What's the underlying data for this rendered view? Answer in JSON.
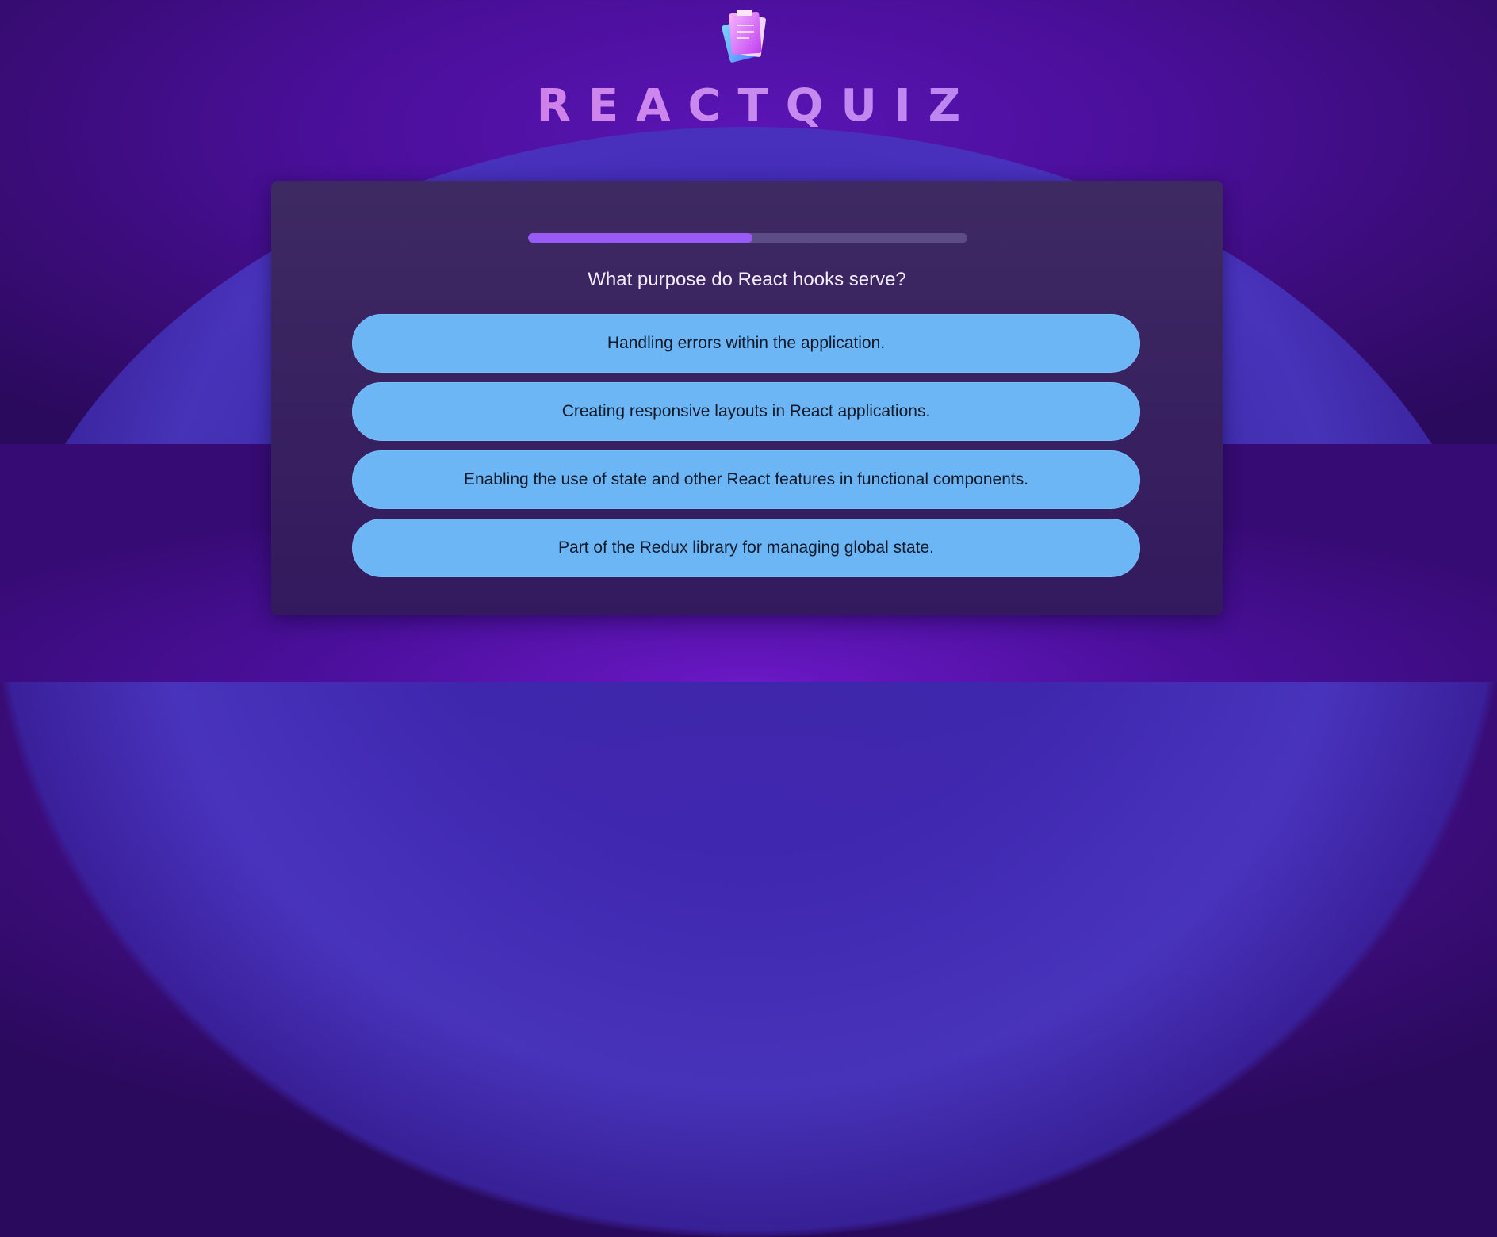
{
  "app": {
    "title": "REACTQUIZ",
    "logo_icon": "quiz-papers-icon"
  },
  "quiz": {
    "progress": 0.51,
    "question": "What purpose do React hooks serve?",
    "options": [
      "Handling errors within the application.",
      "Creating responsive layouts in React applications.",
      "Enabling the use of state and other React features in functional components.",
      "Part of the Redux library for managing global state."
    ]
  },
  "colors": {
    "accent": "#9a5af5",
    "option_bg": "#6cb6f6",
    "card_bg": "#3e2a62",
    "page_bg": "#4a0f9a"
  }
}
